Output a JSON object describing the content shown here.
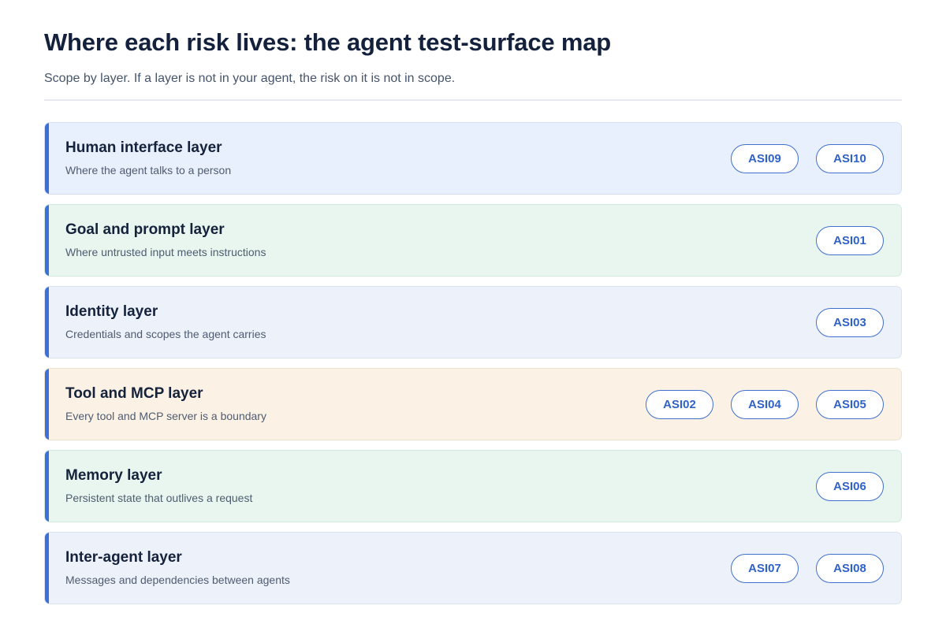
{
  "title": "Where each risk lives: the agent test-surface map",
  "subtitle": "Scope by layer. If a layer is not in your agent, the risk on it is not in scope.",
  "colors": {
    "accent": "#3c6fd8",
    "tag_border": "#3f6fcf",
    "tag_text": "#2f62c9"
  },
  "layers": [
    {
      "name": "Human interface layer",
      "description": "Where the agent talks to a person",
      "background": "#e8effd",
      "border": "#d5e0f7",
      "risks": [
        "ASI09",
        "ASI10"
      ]
    },
    {
      "name": "Goal and prompt layer",
      "description": "Where untrusted input meets instructions",
      "background": "#e8f6ef",
      "border": "#d3ebdf",
      "risks": [
        "ASI01"
      ]
    },
    {
      "name": "Identity layer",
      "description": "Credentials and scopes the agent carries",
      "background": "#edf1fa",
      "border": "#dbe2f1",
      "risks": [
        "ASI03"
      ]
    },
    {
      "name": "Tool and MCP layer",
      "description": "Every tool and MCP server is a boundary",
      "background": "#fbf2e5",
      "border": "#efe3d0",
      "risks": [
        "ASI02",
        "ASI04",
        "ASI05"
      ]
    },
    {
      "name": "Memory layer",
      "description": "Persistent state that outlives a request",
      "background": "#e8f6ef",
      "border": "#d3ebdf",
      "risks": [
        "ASI06"
      ]
    },
    {
      "name": "Inter-agent layer",
      "description": "Messages and dependencies between agents",
      "background": "#edf1fa",
      "border": "#dbe2f1",
      "risks": [
        "ASI07",
        "ASI08"
      ]
    }
  ]
}
